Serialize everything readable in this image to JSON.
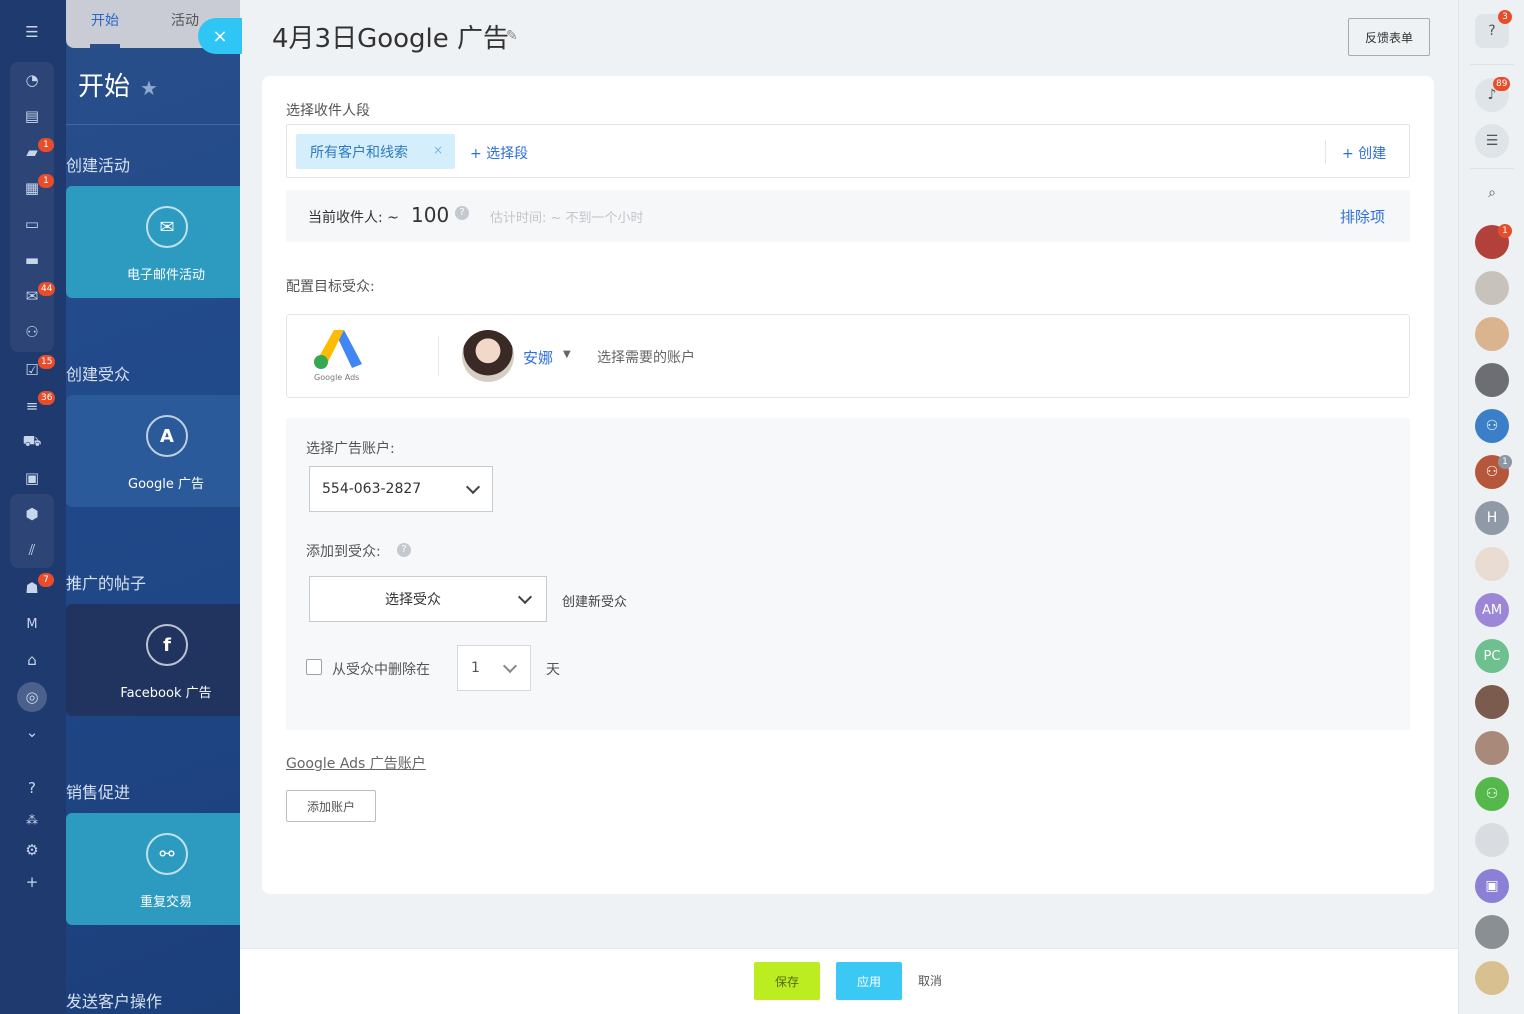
{
  "slider": {
    "tabs": [
      {
        "label": "开始"
      },
      {
        "label": "活动"
      }
    ],
    "close_label": "×"
  },
  "left_panel": {
    "title": "开始",
    "sections": [
      {
        "title": "创建活动",
        "tile": {
          "label": "电子邮件活动",
          "icon": "email-campaign-icon",
          "color": "#2d9bc0"
        }
      },
      {
        "title": "创建受众",
        "tile": {
          "label": "Google 广告",
          "icon": "google-ads-icon",
          "color": "#2b5a9a"
        }
      },
      {
        "title": "推广的帖子",
        "tile": {
          "label": "Facebook 广告",
          "icon": "facebook-icon",
          "color": "#20345f"
        }
      },
      {
        "title": "销售促进",
        "tile": {
          "label": "重复交易",
          "icon": "handshake-icon",
          "color": "#2d9bc0"
        }
      },
      {
        "title": "发送客户操作"
      }
    ]
  },
  "left_rail": {
    "badges": [
      "1",
      "1",
      "44",
      "15",
      "36",
      "7"
    ],
    "m_label": "M"
  },
  "header": {
    "title": "4月3日Google 广告",
    "feedback_label": "反馈表单"
  },
  "segments": {
    "label": "选择收件人段",
    "chip": "所有客户和线索",
    "chip_remove": "×",
    "select_label": "+ 选择段",
    "create_label": "+ 创建"
  },
  "recipients": {
    "label": "当前收件人: ~",
    "count": "100",
    "help": "?",
    "estimate": "估计时间: ~ 不到一个小时",
    "exclusions_label": "排除项"
  },
  "audience": {
    "label": "配置目标受众:",
    "logo_caption": "Google Ads",
    "account_name": "安娜",
    "select_account": "选择需要的账户"
  },
  "settings": {
    "ad_account_label": "选择广告账户:",
    "ad_account_value": "554-063-2827",
    "add_to_audience_label": "添加到受众:",
    "help": "?",
    "audience_select_value": "选择受众",
    "create_audience_label": "创建新受众",
    "remove_label": "从受众中删除在",
    "days_value": "1",
    "days_unit": "天"
  },
  "gads_accounts": {
    "link_label": "Google Ads 广告账户",
    "add_account_label": "添加账户"
  },
  "footer": {
    "save_label": "保存",
    "apply_label": "应用",
    "cancel_label": "取消"
  },
  "right_rail": {
    "help_badge": "3",
    "notifications_badge": "89",
    "user_badge_1": "1",
    "group_badge": "1",
    "initials": [
      "H",
      "AM",
      "PC"
    ]
  },
  "colors": {
    "accent_blue": "#2e6fd8",
    "save_green": "#bbed21",
    "apply_cyan": "#3bc8f5",
    "badge_red": "#e84d2b"
  }
}
